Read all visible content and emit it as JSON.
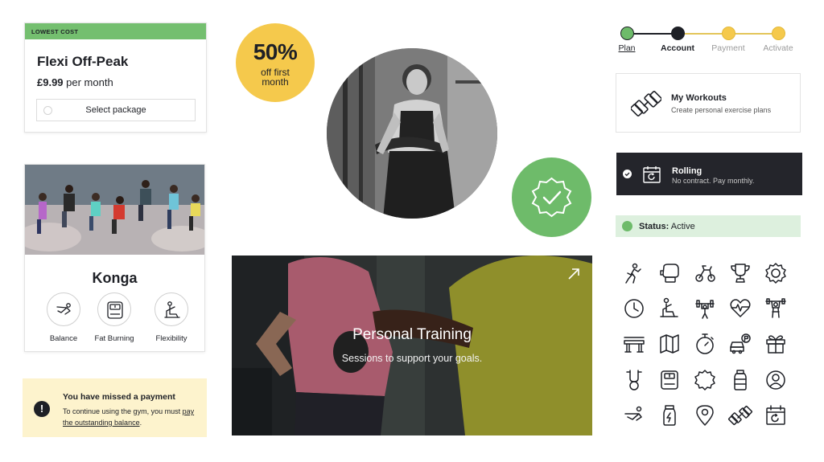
{
  "package": {
    "tag": "LOWEST COST",
    "title": "Flexi Off-Peak",
    "price": "£9.99",
    "price_suffix": " per month",
    "select_label": "Select package"
  },
  "promo": {
    "big": "50%",
    "line1": "off first",
    "line2": "month"
  },
  "stepper": {
    "steps": [
      {
        "label": "Plan",
        "state": "done"
      },
      {
        "label": "Account",
        "state": "current"
      },
      {
        "label": "Payment",
        "state": "todo"
      },
      {
        "label": "Activate",
        "state": "todo"
      }
    ]
  },
  "workouts": {
    "title": "My Workouts",
    "subtitle": "Create personal exercise plans"
  },
  "rolling": {
    "title": "Rolling",
    "subtitle": "No contract. Pay monthly."
  },
  "status": {
    "label": "Status:",
    "value": " Active"
  },
  "class_card": {
    "name": "Konga",
    "features": [
      "Balance",
      "Fat Burning",
      "Flexibility"
    ]
  },
  "alert": {
    "title": "You have missed a payment",
    "text": "To continue using the gym, you must ",
    "link": "pay the outstanding balance",
    "end": "."
  },
  "pt": {
    "title": "Personal Training",
    "subtitle": "Sessions to support your goals."
  },
  "icons": [
    "boxing-figure-icon",
    "boxing-glove-icon",
    "exercise-bike-icon",
    "trophy-icon",
    "medal-icon",
    "clock-icon",
    "stretching-figure-icon",
    "weightlifting-icon",
    "heart-rate-icon",
    "weightlifter-icon",
    "bench-icon",
    "map-icon",
    "stopwatch-icon",
    "car-parking-icon",
    "gift-icon",
    "kettlebell-grip-icon",
    "scale-icon",
    "verified-badge-icon",
    "water-bottle-icon",
    "user-circle-icon",
    "yoga-figure-icon",
    "energy-drink-icon",
    "location-pin-icon",
    "dumbbell-icon",
    "calendar-renew-icon"
  ],
  "colors": {
    "green": "#6ebb6a",
    "yellow": "#f5c94c",
    "dark": "#24252b",
    "text": "#1e2026"
  }
}
